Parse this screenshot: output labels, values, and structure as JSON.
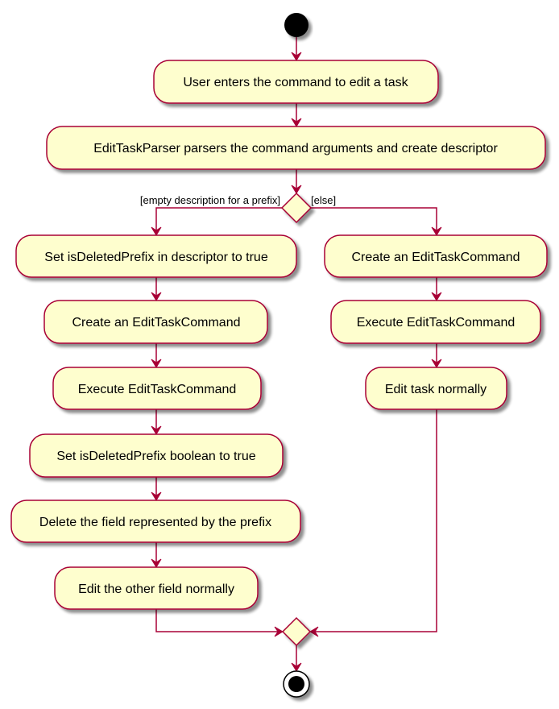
{
  "diagram": {
    "type": "uml-activity",
    "colors": {
      "activity_fill": "#FEFECE",
      "border": "#A80036",
      "arrow": "#A80036",
      "start_fill": "#000000",
      "end_fill": "#000000",
      "shadow": "#888888"
    },
    "start": {
      "label": "start"
    },
    "end": {
      "label": "stop"
    },
    "activities": {
      "user_enters": "User enters the command to edit a task",
      "parser": "EditTaskParser parsers the command arguments and create descriptor",
      "set_prefix_descriptor": "Set isDeletedPrefix in descriptor to true",
      "create_cmd_left": "Create an EditTaskCommand",
      "execute_cmd_left": "Execute EditTaskCommand",
      "set_prefix_boolean": "Set isDeletedPrefix boolean to true",
      "delete_field": "Delete the field represented by the prefix",
      "edit_other": "Edit the other field normally",
      "create_cmd_right": "Create an EditTaskCommand",
      "execute_cmd_right": "Execute EditTaskCommand",
      "edit_normally": "Edit task normally"
    },
    "decision": {
      "guard_left": "[empty description for a prefix]",
      "guard_right": "[else]"
    }
  }
}
